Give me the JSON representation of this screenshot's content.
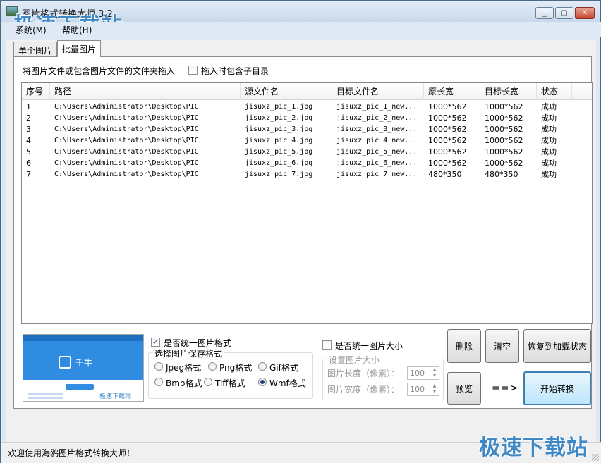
{
  "window": {
    "title": "图片格式转换大师 3.2",
    "watermark": "极速下载站"
  },
  "menu": {
    "items": [
      "系统(M)",
      "帮助(H)"
    ]
  },
  "tabs": [
    "单个图片",
    "批量图片"
  ],
  "batch": {
    "instruction": "将图片文件或包含图片文件的文件夹拖入",
    "include_subdir_label": "拖入时包含子目录",
    "include_subdir_checked": false,
    "columns": [
      "序号",
      "路径",
      "源文件名",
      "目标文件名",
      "原长宽",
      "目标长宽",
      "状态"
    ],
    "rows": [
      [
        "1",
        "C:\\Users\\Administrator\\Desktop\\PIC",
        "jisuxz_pic_1.jpg",
        "jisuxz_pic_1_new...",
        "1000*562",
        "1000*562",
        "成功"
      ],
      [
        "2",
        "C:\\Users\\Administrator\\Desktop\\PIC",
        "jisuxz_pic_2.jpg",
        "jisuxz_pic_2_new...",
        "1000*562",
        "1000*562",
        "成功"
      ],
      [
        "3",
        "C:\\Users\\Administrator\\Desktop\\PIC",
        "jisuxz_pic_3.jpg",
        "jisuxz_pic_3_new...",
        "1000*562",
        "1000*562",
        "成功"
      ],
      [
        "4",
        "C:\\Users\\Administrator\\Desktop\\PIC",
        "jisuxz_pic_4.jpg",
        "jisuxz_pic_4_new...",
        "1000*562",
        "1000*562",
        "成功"
      ],
      [
        "5",
        "C:\\Users\\Administrator\\Desktop\\PIC",
        "jisuxz_pic_5.jpg",
        "jisuxz_pic_5_new...",
        "1000*562",
        "1000*562",
        "成功"
      ],
      [
        "6",
        "C:\\Users\\Administrator\\Desktop\\PIC",
        "jisuxz_pic_6.jpg",
        "jisuxz_pic_6_new...",
        "1000*562",
        "1000*562",
        "成功"
      ],
      [
        "7",
        "C:\\Users\\Administrator\\Desktop\\PIC",
        "jisuxz_pic_7.jpg",
        "jisuxz_pic_7_new...",
        "480*350",
        "480*350",
        "成功"
      ]
    ]
  },
  "preview": {
    "app_name": "千牛",
    "watermark": "极速下载站"
  },
  "format": {
    "unify_label": "是否统一图片格式",
    "unify_checked": true,
    "group_title": "选择图片保存格式",
    "options": [
      "Jpeg格式",
      "Png格式",
      "Gif格式",
      "Bmp格式",
      "Tiff格式",
      "Wmf格式"
    ],
    "selected": "Wmf格式"
  },
  "size": {
    "unify_label": "是否统一图片大小",
    "unify_checked": false,
    "group_title": "设置图片大小",
    "length_label": "图片长度（像素）：",
    "width_label": "图片宽度（像素）：",
    "length_value": "100",
    "width_value": "100"
  },
  "buttons": {
    "delete": "删除",
    "clear": "清空",
    "restore": "恢复到加载状态",
    "preview": "预览",
    "arrow": "==>",
    "start": "开始转换"
  },
  "status": {
    "text": "欢迎使用海鸥图片格式转换大师！"
  }
}
